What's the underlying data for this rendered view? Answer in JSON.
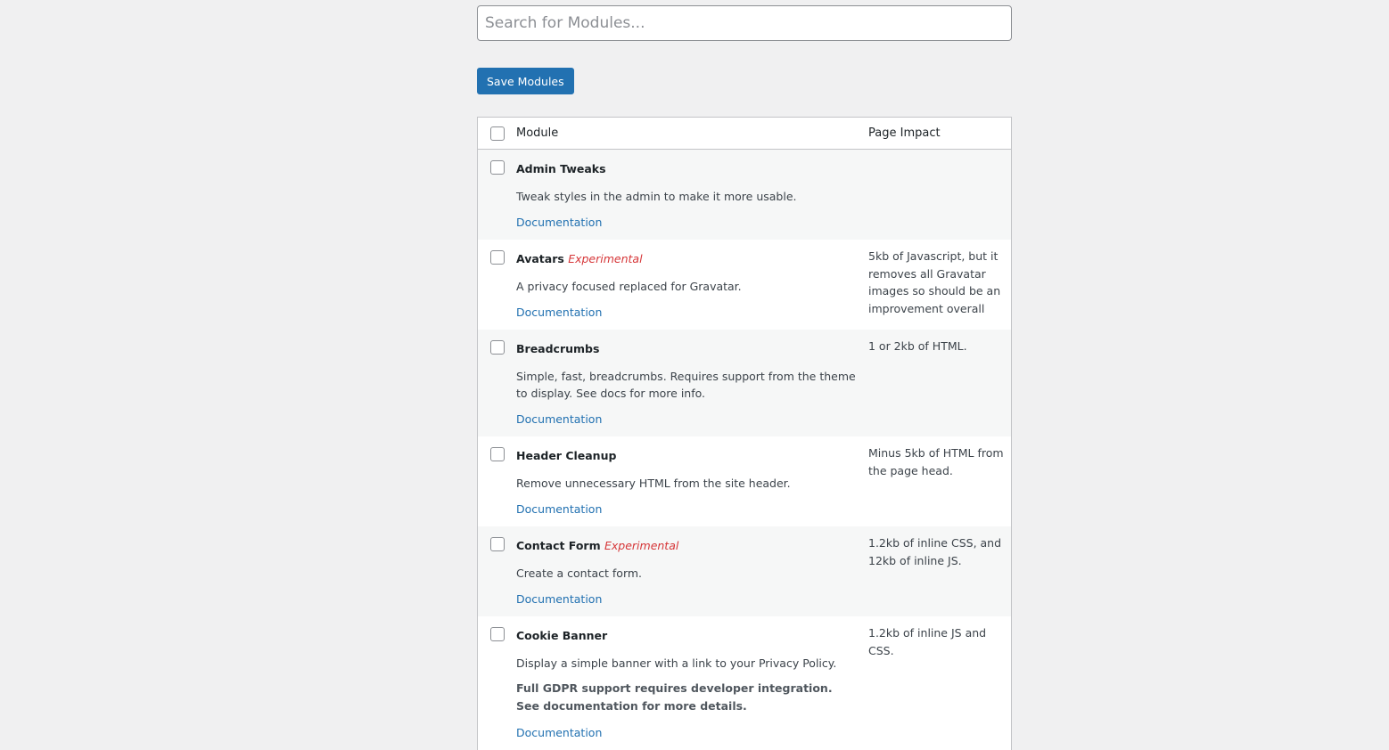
{
  "search": {
    "placeholder": "Search for Modules...",
    "value": ""
  },
  "save_button": {
    "label": "Save Modules"
  },
  "table": {
    "headers": {
      "module": "Module",
      "impact": "Page Impact"
    },
    "rows": [
      {
        "name": "Admin Tweaks",
        "tag": "",
        "description": "Tweak styles in the admin to make it more usable.",
        "note": "",
        "link": "Documentation",
        "impact": ""
      },
      {
        "name": "Avatars",
        "tag": "Experimental",
        "description": "A privacy focused replaced for Gravatar.",
        "note": "",
        "link": "Documentation",
        "impact": "5kb of Javascript, but it removes all Gravatar images so should be an improvement overall"
      },
      {
        "name": "Breadcrumbs",
        "tag": "",
        "description": "Simple, fast, breadcrumbs. Requires support from the theme to display. See docs for more info.",
        "note": "",
        "link": "Documentation",
        "impact": "1 or 2kb of HTML."
      },
      {
        "name": "Header Cleanup",
        "tag": "",
        "description": "Remove unnecessary HTML from the site header.",
        "note": "",
        "link": "Documentation",
        "impact": "Minus 5kb of HTML from the page head."
      },
      {
        "name": "Contact Form",
        "tag": "Experimental",
        "description": "Create a contact form.",
        "note": "",
        "link": "Documentation",
        "impact": "1.2kb of inline CSS, and 12kb of inline JS."
      },
      {
        "name": "Cookie Banner",
        "tag": "",
        "description": "Display a simple banner with a link to your Privacy Policy.",
        "note": "Full GDPR support requires developer integration. See documentation for more details.",
        "link": "Documentation",
        "impact": "1.2kb of inline JS and CSS."
      }
    ]
  },
  "colors": {
    "accent": "#2271b1",
    "experimental": "#d63638",
    "background": "#f0f0f1"
  }
}
